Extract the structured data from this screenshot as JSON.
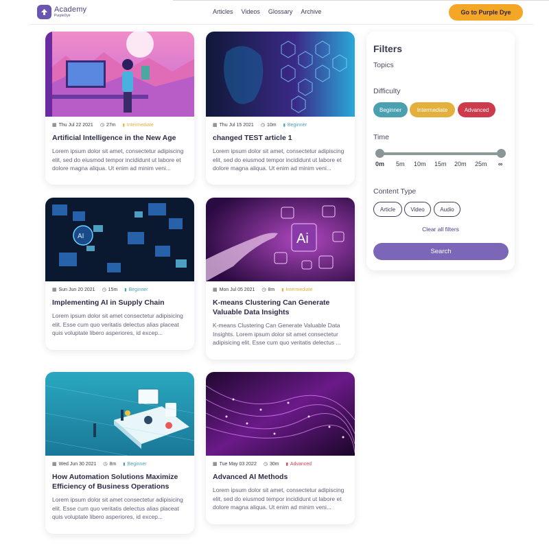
{
  "header": {
    "logo_title": "Academy",
    "logo_sub": "PurpleDye",
    "nav": [
      "Articles",
      "Videos",
      "Glossary",
      "Archive"
    ],
    "cta_label": "Go to Purple Dye"
  },
  "articles": [
    {
      "date": "Thu Jul 22 2021",
      "duration": "27m",
      "level": "Intermediate",
      "title": "Artificial Intelligence in the New Age",
      "excerpt": "Lorem ipsum dolor sit amet, consectetur adipiscing elit, sed do eiusmod tempor incididunt ut labore et dolore magna aliqua. Ut enim ad minim veni..."
    },
    {
      "date": "Thu Jul 15 2021",
      "duration": "10m",
      "level": "Beginner",
      "title": "changed TEST article 1",
      "excerpt": "Lorem ipsum dolor sit amet, consectetur adipiscing elit, sed do eiusmod tempor incididunt ut labore et dolore magna aliqua. Ut enim ad minim veni..."
    },
    {
      "date": "Sun Jun 20 2021",
      "duration": "15m",
      "level": "Beginner",
      "title": "Implementing AI in Supply Chain",
      "excerpt": "Lorem ipsum dolor sit amet consectetur adipisicing elit. Esse cum quo veritatis delectus alias placeat quis voluptate libero asperiores, id excep..."
    },
    {
      "date": "Mon Jul 05 2021",
      "duration": "8m",
      "level": "Intermediate",
      "title": "K-means Clustering Can Generate Valuable Data Insights",
      "excerpt": "K-means Clustering Can Generate Valuable Data Insights. Lorem ipsum dolor sit amet consectetur adipisicing elit. Esse cum quo veritatis delectus ..."
    },
    {
      "date": "Wed Jun 30 2021",
      "duration": "8m",
      "level": "Beginner",
      "title": "How Automation Solutions Maximize Efficiency of Business Operations",
      "excerpt": "Lorem ipsum dolor sit amet consectetur adipisicing elit. Esse cum quo veritatis delectus alias placeat quis voluptate libero asperiores, id excep..."
    },
    {
      "date": "Tue May 03 2022",
      "duration": "30m",
      "level": "Advanced",
      "title": "Advanced AI Methods",
      "excerpt": "Lorem ipsum dolor sit amet, consectetur adipiscing elit, sed do eiusmod tempor incididunt ut labore et dolore magna aliqua. Ut enim ad minim veni..."
    }
  ],
  "filters": {
    "title": "Filters",
    "topics_label": "Topics",
    "difficulty_label": "Difficulty",
    "difficulty_options": [
      "Beginner",
      "Intermediate",
      "Advanced"
    ],
    "time_label": "Time",
    "time_ticks": [
      "0m",
      "5m",
      "10m",
      "15m",
      "20m",
      "25m",
      "∞"
    ],
    "content_type_label": "Content Type",
    "content_types": [
      "Article",
      "Video",
      "Audio"
    ],
    "clear_label": "Clear all filters",
    "search_label": "Search"
  },
  "colors": {
    "brand_purple": "#6a55b0",
    "cta_orange": "#f4a726",
    "beginner": "#4a9fb0",
    "intermediate": "#e3b03d",
    "advanced": "#cc3a4b",
    "search_button": "#7b66b8"
  },
  "icons": {
    "date": "calendar-icon",
    "duration": "clock-icon",
    "level": "signal-bars-icon"
  }
}
